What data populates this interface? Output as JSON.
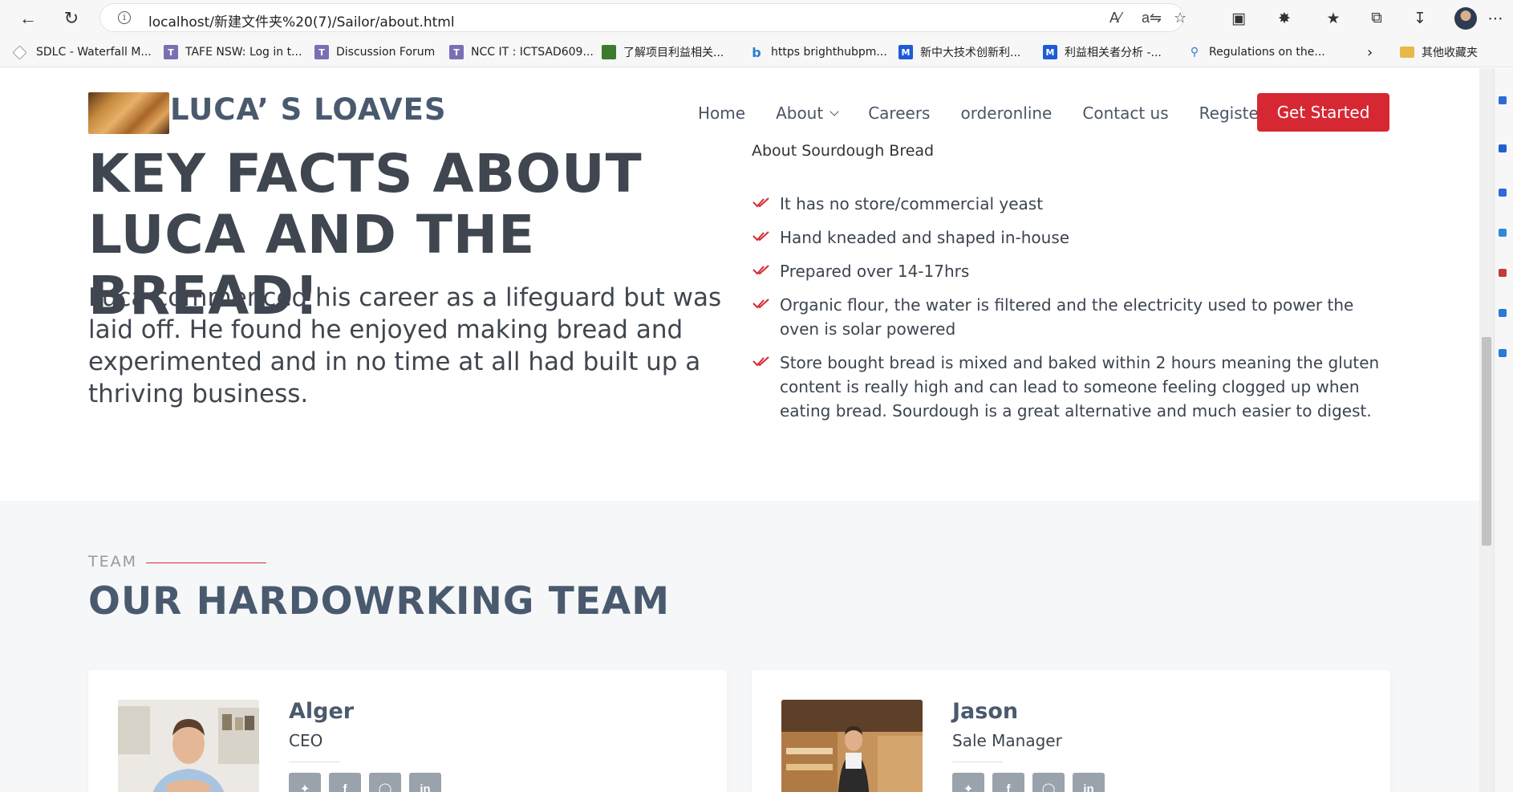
{
  "browser": {
    "url": "localhost/新建文件夹%20(7)/Sailor/about.html",
    "bookmarks": [
      {
        "label": "SDLC - Waterfall M...",
        "icon": "sdlc-favicon"
      },
      {
        "label": "TAFE NSW: Log in t...",
        "icon": "tafe-favicon"
      },
      {
        "label": "Discussion Forum",
        "icon": "tafe-favicon"
      },
      {
        "label": "NCC IT : ICTSAD609...",
        "icon": "tafe-favicon"
      },
      {
        "label": "了解项目利益相关...",
        "icon": "green-favicon"
      },
      {
        "label": "https brighthubpm...",
        "icon": "bing-favicon"
      },
      {
        "label": "新中大技术创新利...",
        "icon": "m-favicon"
      },
      {
        "label": "利益相关者分析 -...",
        "icon": "m-favicon"
      },
      {
        "label": "Regulations on the...",
        "icon": "search-favicon"
      }
    ],
    "other_bookmarks": "其他收藏夹"
  },
  "site": {
    "logo_text": "LUCA’ S LOAVES",
    "nav": {
      "home": "Home",
      "about": "About",
      "careers": "Careers",
      "orderonline": "orderonline",
      "contact": "Contact us",
      "register": "Register"
    },
    "cta": "Get Started"
  },
  "key_facts": {
    "partial_heading": "About Sourdough Bread",
    "title": "KEY FACTS ABOUT LUCA AND THE BREAD!",
    "story": "Luca commenced his career as a lifeguard but was laid off. He found he enjoyed making bread and experimented and in no time at all had built up a thriving business.",
    "facts": [
      "It has no store/commercial yeast",
      "Hand kneaded and shaped in-house",
      "Prepared over 14-17hrs",
      "Organic flour, the water is filtered and the electricity used to power the oven is solar powered",
      "Store bought bread is mixed and baked within 2 hours meaning the gluten content is really high and can lead to someone feeling clogged up when eating bread. Sourdough is a great alternative and much easier to digest."
    ]
  },
  "team": {
    "eyebrow": "TEAM",
    "title": "OUR HARDOWRKING TEAM",
    "members": [
      {
        "name": "Alger",
        "role": "CEO"
      },
      {
        "name": "Jason",
        "role": "Sale Manager"
      }
    ]
  },
  "colors": {
    "accent": "#d62833",
    "heading": "#4a5a6e",
    "section_bg": "#f6f7f9"
  }
}
